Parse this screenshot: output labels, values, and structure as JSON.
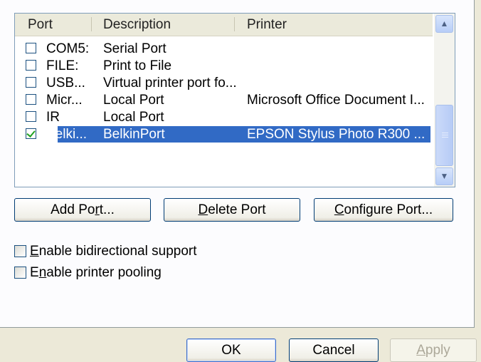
{
  "ports_list": {
    "columns": [
      "Port",
      "Description",
      "Printer"
    ],
    "rows": [
      {
        "port": "COM5:",
        "description": "Serial Port",
        "printer": "",
        "checked": false,
        "selected": false
      },
      {
        "port": "FILE:",
        "description": "Print to File",
        "printer": "",
        "checked": false,
        "selected": false
      },
      {
        "port": "USB...",
        "description": "Virtual printer port fo...",
        "printer": "",
        "checked": false,
        "selected": false
      },
      {
        "port": "Micr...",
        "description": "Local Port",
        "printer": "Microsoft Office Document I...",
        "checked": false,
        "selected": false
      },
      {
        "port": "IR",
        "description": "Local Port",
        "printer": "",
        "checked": false,
        "selected": false
      },
      {
        "port": "Belki...",
        "description": "BelkinPort",
        "printer": "EPSON Stylus Photo R300 ...",
        "checked": true,
        "selected": true
      }
    ]
  },
  "port_buttons": {
    "add": {
      "pre": "Add Po",
      "key": "r",
      "post": "t..."
    },
    "delete": {
      "pre": "",
      "key": "D",
      "post": "elete Port"
    },
    "configure": {
      "pre": "",
      "key": "C",
      "post": "onfigure Port..."
    }
  },
  "options": {
    "bidirectional": {
      "pre": "",
      "key": "E",
      "post": "nable bidirectional support",
      "checked": false
    },
    "pooling": {
      "pre": "E",
      "key": "n",
      "post": "able printer pooling",
      "checked": false
    }
  },
  "dialog_buttons": {
    "ok": "OK",
    "cancel": "Cancel",
    "apply": {
      "pre": "",
      "key": "A",
      "post": "pply"
    }
  },
  "colors": {
    "selection": "#316ac5",
    "dialog_bg": "#ece9d8",
    "tab_bg": "#fcfcfe"
  }
}
